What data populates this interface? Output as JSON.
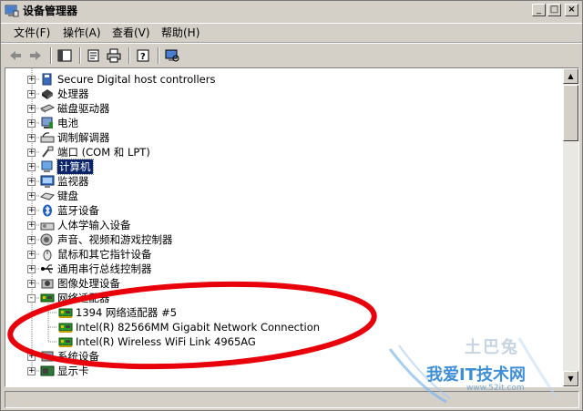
{
  "window": {
    "title": "设备管理器",
    "controls": {
      "minimize": "_",
      "restore": "□",
      "close": "×"
    }
  },
  "menubar": {
    "items": [
      {
        "label": "文件(F)"
      },
      {
        "label": "操作(A)"
      },
      {
        "label": "查看(V)"
      },
      {
        "label": "帮助(H)"
      }
    ]
  },
  "toolbar": {
    "buttons": [
      "back-icon",
      "forward-icon",
      "show-hide-tree-icon",
      "properties-icon",
      "print-icon",
      "help-icon",
      "scan-hardware-icon"
    ]
  },
  "tree": {
    "rows": [
      {
        "label": "Secure Digital host controllers",
        "icon": "sd-controller-icon",
        "level": 1,
        "expander": "+"
      },
      {
        "label": "处理器",
        "icon": "processor-icon",
        "level": 1,
        "expander": "+"
      },
      {
        "label": "磁盘驱动器",
        "icon": "disk-drive-icon",
        "level": 1,
        "expander": "+"
      },
      {
        "label": "电池",
        "icon": "battery-icon",
        "level": 1,
        "expander": "+"
      },
      {
        "label": "调制解调器",
        "icon": "modem-icon",
        "level": 1,
        "expander": "+"
      },
      {
        "label": "端口 (COM 和 LPT)",
        "icon": "port-icon",
        "level": 1,
        "expander": "+"
      },
      {
        "label": "计算机",
        "icon": "computer-icon",
        "level": 1,
        "expander": "+",
        "selected": true
      },
      {
        "label": "监视器",
        "icon": "monitor-icon",
        "level": 1,
        "expander": "+"
      },
      {
        "label": "键盘",
        "icon": "keyboard-icon",
        "level": 1,
        "expander": "+"
      },
      {
        "label": "蓝牙设备",
        "icon": "bluetooth-icon",
        "level": 1,
        "expander": "+"
      },
      {
        "label": "人体学输入设备",
        "icon": "hid-icon",
        "level": 1,
        "expander": "+"
      },
      {
        "label": "声音、视频和游戏控制器",
        "icon": "sound-icon",
        "level": 1,
        "expander": "+"
      },
      {
        "label": "鼠标和其它指针设备",
        "icon": "mouse-icon",
        "level": 1,
        "expander": "+"
      },
      {
        "label": "通用串行总线控制器",
        "icon": "usb-icon",
        "level": 1,
        "expander": "+"
      },
      {
        "label": "图像处理设备",
        "icon": "imaging-icon",
        "level": 1,
        "expander": "+"
      },
      {
        "label": "网络适配器",
        "icon": "network-adapter-icon",
        "level": 1,
        "expander": "-"
      },
      {
        "label": "1394 网络适配器 #5",
        "icon": "network-card-icon",
        "level": 2
      },
      {
        "label": "Intel(R) 82566MM Gigabit Network Connection",
        "icon": "network-card-icon",
        "level": 2
      },
      {
        "label": "Intel(R) Wireless WiFi Link 4965AG",
        "icon": "network-card-icon",
        "level": 2
      },
      {
        "label": "系统设备",
        "icon": "system-device-icon",
        "level": 1,
        "expander": "+"
      },
      {
        "label": "显示卡",
        "icon": "display-adapter-icon",
        "level": 1,
        "expander": "+"
      }
    ]
  },
  "watermark": {
    "text": "我爱IT技术网",
    "subtext": "www.52it.com",
    "brand": "土巴兔"
  },
  "colors": {
    "selection": "#0a246a",
    "annotation": "#e8000a",
    "watermark": "#3f8fd8"
  }
}
